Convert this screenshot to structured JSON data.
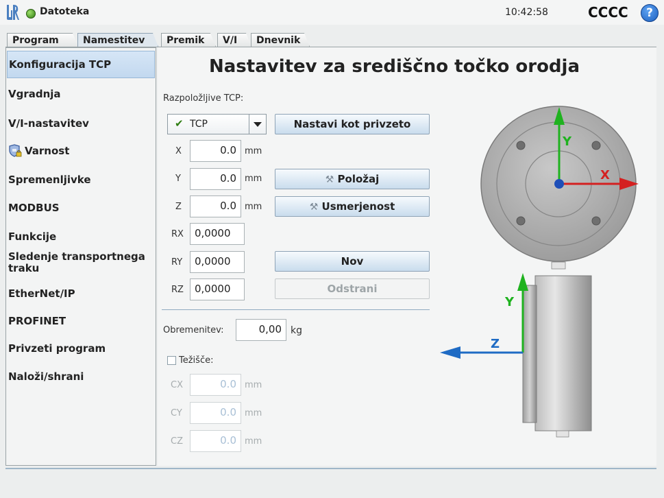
{
  "topbar": {
    "file_label": "Datoteka",
    "clock": "10:42:58",
    "robot_name": "CCCC",
    "help_symbol": "?"
  },
  "tabs": [
    {
      "label": "Program",
      "active": false
    },
    {
      "label": "Namestitev",
      "active": true
    },
    {
      "label": "Premik",
      "active": false
    },
    {
      "label": "V/I",
      "active": false
    },
    {
      "label": "Dnevnik",
      "active": false
    }
  ],
  "sidebar": {
    "items": [
      {
        "label": "Konfiguracija TCP",
        "selected": true
      },
      {
        "label": "Vgradnja"
      },
      {
        "label": "V/I-nastavitev"
      },
      {
        "label": "Varnost",
        "icon": "shield-lock-icon"
      },
      {
        "label": "Spremenljivke"
      },
      {
        "label": "MODBUS"
      },
      {
        "label": "Funkcije"
      },
      {
        "label": "Sledenje transportnega traku"
      },
      {
        "label": "EtherNet/IP"
      },
      {
        "label": "PROFINET"
      },
      {
        "label": "Privzeti program"
      },
      {
        "label": "Naloži/shrani"
      }
    ]
  },
  "main": {
    "title": "Nastavitev za središčno točko orodja",
    "available_tcp_label": "Razpoložljive TCP:",
    "tcp_select": {
      "value": "TCP",
      "icon": "check-icon"
    },
    "set_default_button": "Nastavi kot privzeto",
    "position_button": "Položaj",
    "orientation_button": "Usmerjenost",
    "new_button": "Nov",
    "remove_button": "Odstrani",
    "coords": {
      "x": {
        "label": "X",
        "value": "0.0",
        "unit": "mm"
      },
      "y": {
        "label": "Y",
        "value": "0.0",
        "unit": "mm"
      },
      "z": {
        "label": "Z",
        "value": "0.0",
        "unit": "mm"
      },
      "rx": {
        "label": "RX",
        "value": "0,0000"
      },
      "ry": {
        "label": "RY",
        "value": "0,0000"
      },
      "rz": {
        "label": "RZ",
        "value": "0,0000"
      }
    },
    "payload": {
      "label": "Obremenitev:",
      "value": "0,00",
      "unit": "kg"
    },
    "cog": {
      "label": "Težišče:",
      "checked": false,
      "cx": {
        "label": "CX",
        "value": "0.0",
        "unit": "mm"
      },
      "cy": {
        "label": "CY",
        "value": "0.0",
        "unit": "mm"
      },
      "cz": {
        "label": "CZ",
        "value": "0.0",
        "unit": "mm"
      }
    },
    "diagram": {
      "axis_x": "X",
      "axis_y_top": "Y",
      "axis_y_side": "Y",
      "axis_z": "Z",
      "colors": {
        "x": "#d42020",
        "y": "#1fb21f",
        "z": "#1e6bc4"
      }
    }
  },
  "colors": {
    "selection": "#c9dcef",
    "button": "#d6e5f2",
    "background": "#eceeee"
  }
}
